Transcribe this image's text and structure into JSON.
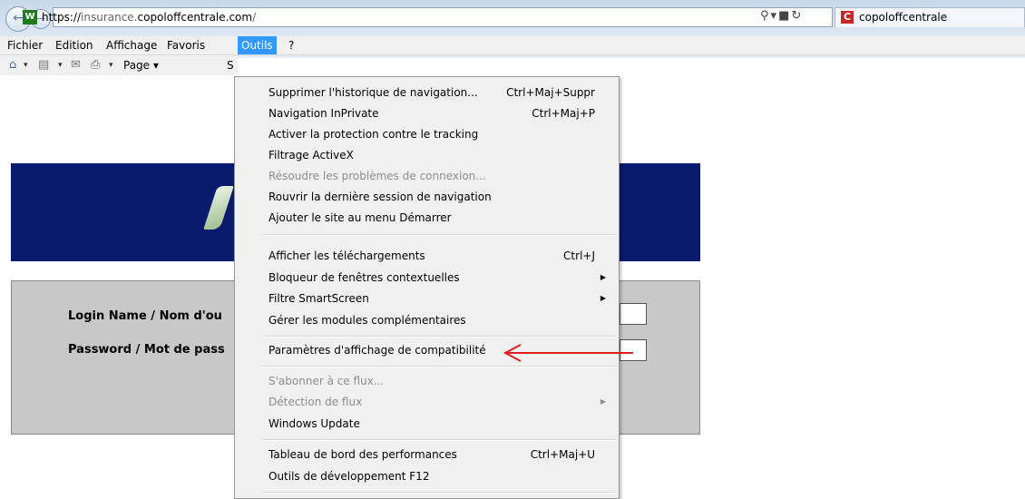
{
  "browser": {
    "url": {
      "scheme": "https://",
      "subdomain": "insurance.",
      "domain": "copoloffcentrale.com",
      "path": "/"
    },
    "tab_title": "copoloffcentrale"
  },
  "menubar": {
    "items": [
      "Fichier",
      "Edition",
      "Affichage",
      "Favoris",
      "Outils",
      "?"
    ]
  },
  "toolbar": {
    "page_label": "Page ▾",
    "s_label": "S"
  },
  "login": {
    "login_label": "Login Name / Nom d'ou",
    "password_label": "Password / Mot de pass"
  },
  "tools_menu": {
    "items": [
      {
        "label": "Supprimer l'historique de navigation...",
        "shortcut": "Ctrl+Maj+Suppr"
      },
      {
        "label": "Navigation InPrivate",
        "shortcut": "Ctrl+Maj+P"
      },
      {
        "label": "Activer la protection contre le tracking",
        "shortcut": ""
      },
      {
        "label": "Filtrage ActiveX",
        "shortcut": ""
      },
      {
        "label": "Résoudre les problèmes de connexion...",
        "shortcut": ""
      },
      {
        "label": "Rouvrir la dernière session de navigation",
        "shortcut": ""
      },
      {
        "label": "Ajouter le site au menu Démarrer",
        "shortcut": ""
      },
      {
        "label": "Afficher les téléchargements",
        "shortcut": "Ctrl+J"
      },
      {
        "label": "Bloqueur de fenêtres contextuelles",
        "shortcut": ""
      },
      {
        "label": "Filtre SmartScreen",
        "shortcut": ""
      },
      {
        "label": "Gérer les modules complémentaires",
        "shortcut": ""
      },
      {
        "label": "Paramètres d'affichage de compatibilité",
        "shortcut": ""
      },
      {
        "label": "S'abonner à ce flux...",
        "shortcut": ""
      },
      {
        "label": "Détection de flux",
        "shortcut": ""
      },
      {
        "label": "Windows Update",
        "shortcut": ""
      },
      {
        "label": "Tableau de bord des performances",
        "shortcut": "Ctrl+Maj+U"
      },
      {
        "label": "Outils de développement F12",
        "shortcut": ""
      }
    ]
  },
  "colors": {
    "menu_highlight": "#3399ff",
    "banner": "#0a1b6e",
    "annotation_arrow": "#e02020",
    "login_panel": "#c8c8c8"
  }
}
